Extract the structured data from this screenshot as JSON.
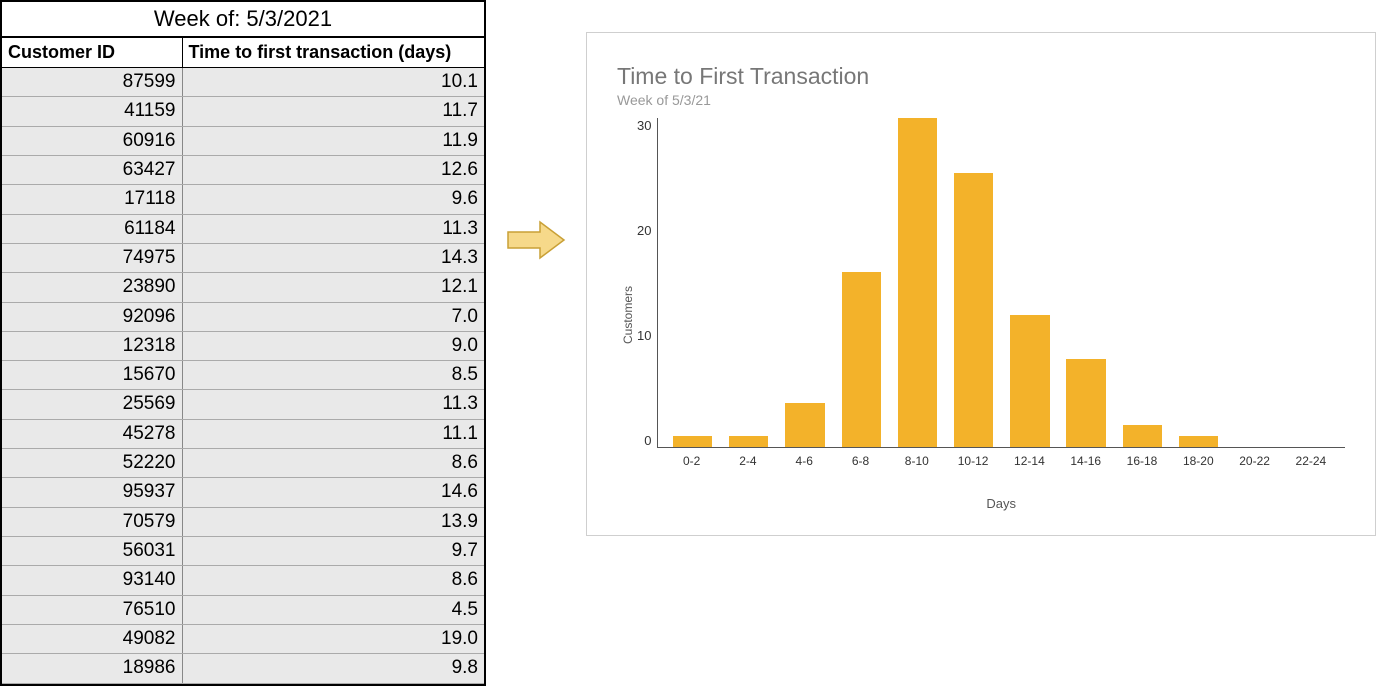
{
  "table": {
    "title": "Week of: 5/3/2021",
    "headers": [
      "Customer ID",
      "Time to first transaction (days)"
    ],
    "rows": [
      {
        "id": "87599",
        "days": "10.1"
      },
      {
        "id": "41159",
        "days": "11.7"
      },
      {
        "id": "60916",
        "days": "11.9"
      },
      {
        "id": "63427",
        "days": "12.6"
      },
      {
        "id": "17118",
        "days": "9.6"
      },
      {
        "id": "61184",
        "days": "11.3"
      },
      {
        "id": "74975",
        "days": "14.3"
      },
      {
        "id": "23890",
        "days": "12.1"
      },
      {
        "id": "92096",
        "days": "7.0"
      },
      {
        "id": "12318",
        "days": "9.0"
      },
      {
        "id": "15670",
        "days": "8.5"
      },
      {
        "id": "25569",
        "days": "11.3"
      },
      {
        "id": "45278",
        "days": "11.1"
      },
      {
        "id": "52220",
        "days": "8.6"
      },
      {
        "id": "95937",
        "days": "14.6"
      },
      {
        "id": "70579",
        "days": "13.9"
      },
      {
        "id": "56031",
        "days": "9.7"
      },
      {
        "id": "93140",
        "days": "8.6"
      },
      {
        "id": "76510",
        "days": "4.5"
      },
      {
        "id": "49082",
        "days": "19.0"
      },
      {
        "id": "18986",
        "days": "9.8"
      }
    ]
  },
  "chart_data": {
    "type": "bar",
    "title": "Time to First Transaction",
    "subtitle": "Week of 5/3/21",
    "xlabel": "Days",
    "ylabel": "Customers",
    "ylim": [
      0,
      30
    ],
    "y_ticks": [
      30,
      20,
      10,
      0
    ],
    "categories": [
      "0-2",
      "2-4",
      "4-6",
      "6-8",
      "8-10",
      "10-12",
      "12-14",
      "14-16",
      "16-18",
      "18-20",
      "20-22",
      "22-24"
    ],
    "values": [
      1,
      1,
      4,
      16,
      30,
      25,
      12,
      8,
      2,
      1,
      0,
      0
    ],
    "bar_color": "#f3b22a"
  }
}
